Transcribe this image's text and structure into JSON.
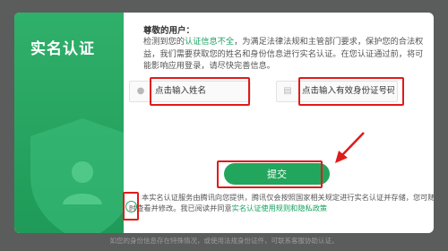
{
  "side": {
    "title": "实名认证"
  },
  "greeting": "尊敬的用户：",
  "desc": {
    "p1": "检测到您的",
    "highlight": "认证信息不全",
    "p2": "，为满足法律法规和主管部门要求，保护您的合法权益，我们需要获取您的姓名和身份信息进行实名认证。在您认证通过前，将可能影响应用登录，请尽快完善信息。"
  },
  "form": {
    "name_placeholder": "点击输入姓名",
    "id_placeholder": "点击输入有效身份证号码",
    "submit_label": "提交"
  },
  "agreement": {
    "text": "本实名认证服务由腾讯向您提供，腾讯仅会按照国家相关规定进行实名认证并存储，您可随时查看并修改。我已阅读并同意",
    "link": "实名认证使用规则和隐私政策"
  },
  "footer": "如您的身份信息存在特殊情况，或使用法规身份证件，可联系客服协助认证。",
  "colors": {
    "brand": "#22a55c",
    "annotation": "#e01b1b"
  }
}
